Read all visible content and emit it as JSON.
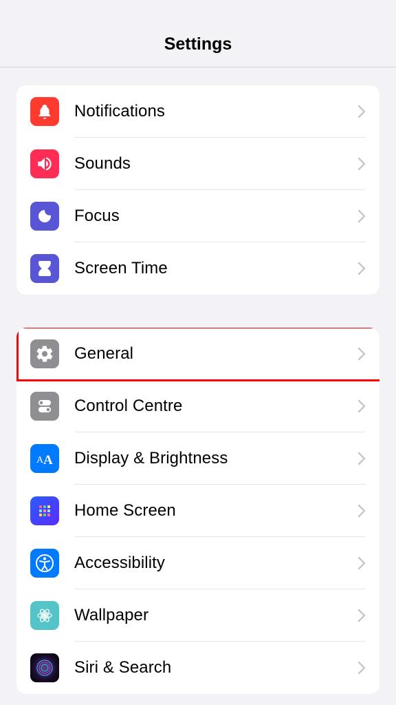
{
  "header": {
    "title": "Settings"
  },
  "group1": [
    {
      "label": "Notifications"
    },
    {
      "label": "Sounds"
    },
    {
      "label": "Focus"
    },
    {
      "label": "Screen Time"
    }
  ],
  "group2": [
    {
      "label": "General",
      "highlighted": true
    },
    {
      "label": "Control Centre"
    },
    {
      "label": "Display & Brightness"
    },
    {
      "label": "Home Screen"
    },
    {
      "label": "Accessibility"
    },
    {
      "label": "Wallpaper"
    },
    {
      "label": "Siri & Search"
    }
  ]
}
